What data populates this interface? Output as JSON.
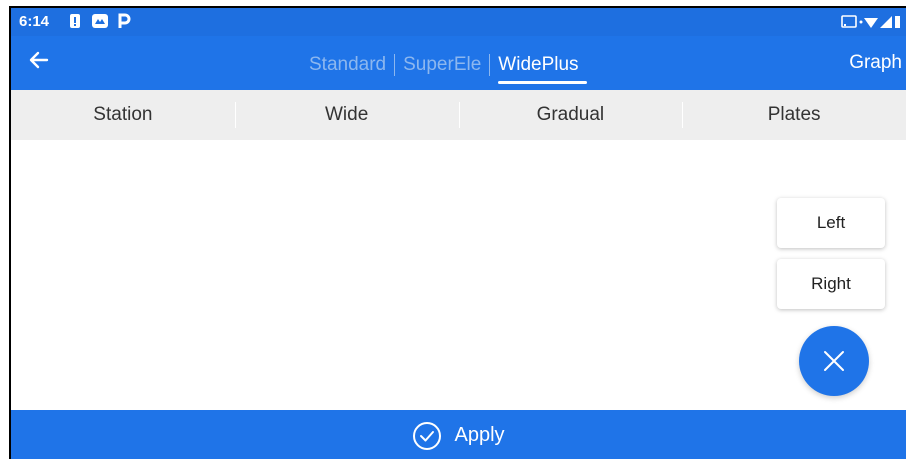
{
  "status_bar": {
    "time": "6:14",
    "notification_icons": [
      "alert-icon",
      "photos-icon",
      "parking-icon"
    ],
    "system_icons": [
      "cast-icon",
      "wifi-icon",
      "signal-icon",
      "battery-icon"
    ]
  },
  "app_bar": {
    "tabs": [
      {
        "label": "Standard",
        "active": false
      },
      {
        "label": "SuperEle",
        "active": false
      },
      {
        "label": "WidePlus",
        "active": true
      }
    ],
    "graph_label": "Graph"
  },
  "table": {
    "columns": [
      "Station",
      "Wide",
      "Gradual",
      "Plates"
    ]
  },
  "actions": {
    "left_label": "Left",
    "right_label": "Right"
  },
  "footer": {
    "apply_label": "Apply"
  },
  "colors": {
    "primary": "#1f74e8",
    "inactive_tab": "#8cb7ef",
    "header_bg": "#eeeeee"
  }
}
